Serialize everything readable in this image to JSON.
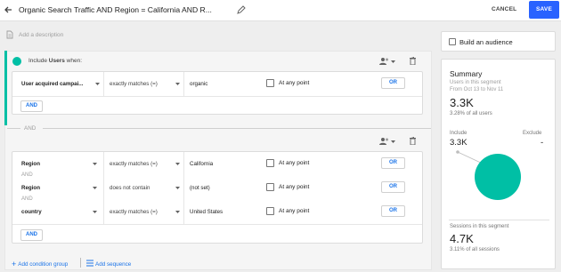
{
  "header": {
    "title": "Organic Search Traffic AND Region = California AND R...",
    "cancel_label": "CANCEL",
    "save_label": "SAVE"
  },
  "description": {
    "placeholder": "Add a description"
  },
  "group1": {
    "include_prefix": "Include ",
    "include_bold": "Users",
    "include_suffix": " when:",
    "conditions": [
      {
        "dimension": "User acquired campai...",
        "operator": "exactly matches (=)",
        "value": "organic",
        "at_any_point": "At any point",
        "or_label": "OR"
      }
    ],
    "and_button": "AND"
  },
  "separator_and": "AND",
  "group2": {
    "conditions": [
      {
        "dimension": "Region",
        "operator": "exactly matches (=)",
        "value": "California",
        "at_any_point": "At any point",
        "or_label": "OR"
      },
      {
        "dimension": "Region",
        "operator": "does not contain",
        "value": "(not set)",
        "at_any_point": "At any point",
        "or_label": "OR"
      },
      {
        "dimension": "country",
        "operator": "exactly matches (=)",
        "value": "United States",
        "at_any_point": "At any point",
        "or_label": "OR"
      }
    ],
    "row_and_labels": [
      "AND",
      "AND"
    ],
    "and_button": "AND"
  },
  "footer": {
    "add_condition_group": "Add condition group",
    "add_sequence": "Add sequence"
  },
  "sidebar": {
    "build_audience": "Build an audience",
    "summary_title": "Summary",
    "users_label": "Users in this segment",
    "date_range": "From Oct 13 to Nov 11",
    "users_value": "3.3K",
    "users_pct": "3.28% of all users",
    "include_label": "Include",
    "exclude_label": "Exclude",
    "include_value": "3.3K",
    "exclude_value": "-",
    "sessions_label": "Sessions in this segment",
    "sessions_value": "4.7K",
    "sessions_pct": "3.11% of all sessions"
  },
  "colors": {
    "accent": "#2962ff",
    "teal": "#00bfa5",
    "link": "#1a73e8"
  },
  "icons": [
    "back-arrow-icon",
    "pencil-icon",
    "description-icon",
    "person-group-icon",
    "trash-icon",
    "chevron-down-icon",
    "add-icon",
    "sequence-icon"
  ]
}
